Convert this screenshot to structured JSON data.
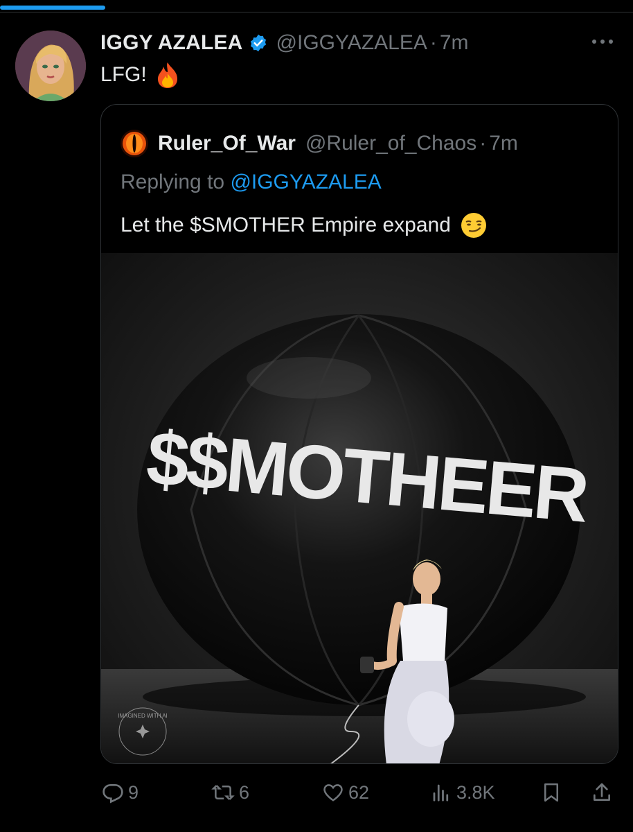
{
  "tweet": {
    "author_name": "IGGY AZALEA",
    "author_handle": "@IGGYAZALEA",
    "separator": "·",
    "time": "7m",
    "text": "LFG!"
  },
  "quoted_tweet": {
    "author_name": "Ruler_Of_War",
    "author_handle": "@Ruler_of_Chaos",
    "separator": "·",
    "time": "7m",
    "replying_prefix": "Replying to ",
    "replying_to": "@IGGYAZALEA",
    "text": "Let the $SMOTHER Empire expand",
    "image_caption_text": "$$MOTHEER",
    "watermark_text": "IMAGINED WITH AI"
  },
  "actions": {
    "replies": "9",
    "reposts": "6",
    "likes": "62",
    "views": "3.8K"
  },
  "icons": {
    "verified": "verified-badge-icon",
    "more": "more-options-icon",
    "fire": "fire-emoji-icon",
    "smirk": "smirk-emoji-icon",
    "reply": "reply-icon",
    "repost": "repost-icon",
    "like": "heart-icon",
    "views": "views-icon",
    "bookmark": "bookmark-icon",
    "share": "share-icon"
  },
  "colors": {
    "background": "#000000",
    "text_primary": "#e7e9ea",
    "text_secondary": "#71767b",
    "accent": "#1d9bf0",
    "border": "#2f3336"
  }
}
